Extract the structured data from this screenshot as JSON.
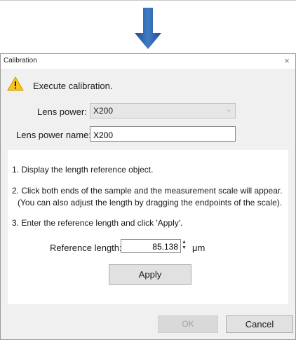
{
  "window": {
    "title": "Calibration",
    "close_glyph": "×"
  },
  "header": {
    "message": "Execute calibration.",
    "lens_power_label": "Lens power:",
    "lens_power_value": "X200",
    "lens_power_name_label": "Lens power name:",
    "lens_power_name_value": "X200"
  },
  "steps": {
    "step1": "1. Display the length reference object.",
    "step2_line1": "2. Click both ends of the sample and the measurement scale will appear.",
    "step2_line2": "(You can also adjust the length by dragging the endpoints of the scale).",
    "step3": "3. Enter the reference length and click 'Apply'."
  },
  "reference": {
    "label": "Reference length:",
    "value": "85.138",
    "unit": "μm"
  },
  "buttons": {
    "apply": "Apply",
    "ok": "OK",
    "cancel": "Cancel"
  },
  "icons": {
    "arrow": "down-arrow-icon",
    "warning": "warning-icon",
    "dropdown": "chevron-down-icon",
    "spinner": "spinner-icon"
  },
  "colors": {
    "arrow": "#2f6cb4",
    "warning_fill": "#f5c518",
    "disabled_text": "#a3a3a3"
  }
}
